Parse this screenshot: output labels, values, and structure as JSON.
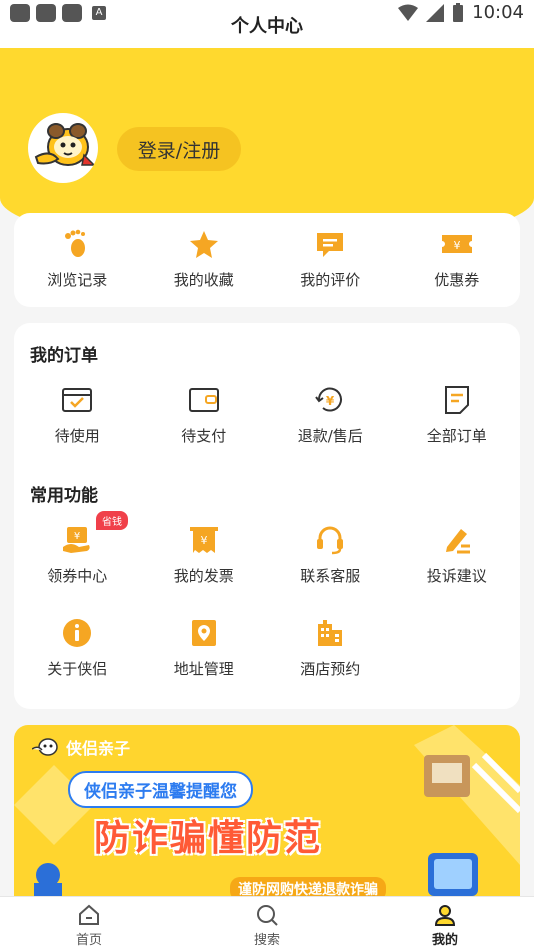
{
  "status_bar": {
    "time": "10:04",
    "a_label": "A"
  },
  "header": {
    "title": "个人中心"
  },
  "profile": {
    "login_label": "登录/注册"
  },
  "quick_links": [
    {
      "label": "浏览记录",
      "icon": "footprint-icon"
    },
    {
      "label": "我的收藏",
      "icon": "star-icon"
    },
    {
      "label": "我的评价",
      "icon": "comment-icon"
    },
    {
      "label": "优惠券",
      "icon": "coupon-icon"
    }
  ],
  "orders": {
    "title": "我的订单",
    "items": [
      {
        "label": "待使用",
        "icon": "to-use-icon"
      },
      {
        "label": "待支付",
        "icon": "wallet-icon"
      },
      {
        "label": "退款/售后",
        "icon": "refund-icon"
      },
      {
        "label": "全部订单",
        "icon": "all-orders-icon"
      }
    ]
  },
  "functions": {
    "title": "常用功能",
    "badge": "省钱",
    "items": [
      {
        "label": "领券中心",
        "icon": "coupon-center-icon"
      },
      {
        "label": "我的发票",
        "icon": "invoice-icon"
      },
      {
        "label": "联系客服",
        "icon": "headset-icon"
      },
      {
        "label": "投诉建议",
        "icon": "feedback-icon"
      },
      {
        "label": "关于侠侣",
        "icon": "info-icon"
      },
      {
        "label": "地址管理",
        "icon": "address-icon"
      },
      {
        "label": "酒店预约",
        "icon": "hotel-icon"
      }
    ]
  },
  "banner": {
    "brand": "侠侣亲子",
    "subtitle": "侠侣亲子温馨提醒您",
    "headline": "防诈骗懂防范",
    "tip": "谨防网购快递退款诈骗"
  },
  "tabbar": {
    "items": [
      {
        "label": "首页",
        "icon": "home-icon"
      },
      {
        "label": "搜索",
        "icon": "search-icon"
      },
      {
        "label": "我的",
        "icon": "user-icon"
      }
    ],
    "active": "我的"
  },
  "colors": {
    "brand_yellow": "#ffd92e",
    "accent_orange": "#f5a623",
    "badge_red": "#f0404a"
  }
}
